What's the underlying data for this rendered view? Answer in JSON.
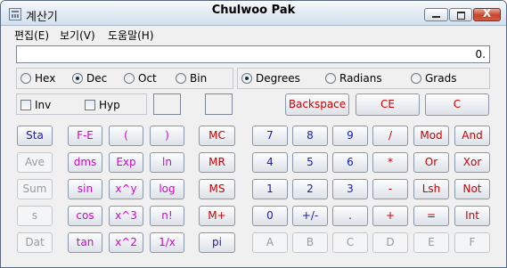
{
  "window": {
    "app_name": "계산기",
    "title": "Chulwoo Pak",
    "controls": {
      "close": "X"
    }
  },
  "menu": [
    "편집(E)",
    "보기(V)",
    "도움말(H)"
  ],
  "display": {
    "value": "0."
  },
  "colors": {
    "blue": "#1a1ab4",
    "red": "#cc0000",
    "magenta": "#d400d4",
    "disabled": "#9a9a9a"
  },
  "base_radios": [
    {
      "label": "Hex",
      "selected": false
    },
    {
      "label": "Dec",
      "selected": true
    },
    {
      "label": "Oct",
      "selected": false
    },
    {
      "label": "Bin",
      "selected": false
    }
  ],
  "angle_radios": [
    {
      "label": "Degrees",
      "selected": true
    },
    {
      "label": "Radians",
      "selected": false
    },
    {
      "label": "Grads",
      "selected": false
    }
  ],
  "checkboxes": [
    {
      "label": "Inv",
      "checked": false
    },
    {
      "label": "Hyp",
      "checked": false
    }
  ],
  "top_buttons": [
    "Backspace",
    "CE",
    "C"
  ],
  "stat_buttons": [
    {
      "label": "Sta",
      "enabled": true
    },
    {
      "label": "Ave",
      "enabled": false
    },
    {
      "label": "Sum",
      "enabled": false
    },
    {
      "label": "s",
      "enabled": false
    },
    {
      "label": "Dat",
      "enabled": false
    }
  ],
  "function_buttons": [
    [
      "F-E",
      "(",
      ")"
    ],
    [
      "dms",
      "Exp",
      "ln"
    ],
    [
      "sin",
      "x^y",
      "log"
    ],
    [
      "cos",
      "x^3",
      "n!"
    ],
    [
      "tan",
      "x^2",
      "1/x"
    ]
  ],
  "memory_buttons": [
    "MC",
    "MR",
    "MS",
    "M+",
    "pi"
  ],
  "number_pad": [
    [
      "7",
      "8",
      "9",
      "/",
      "Mod",
      "And"
    ],
    [
      "4",
      "5",
      "6",
      "*",
      "Or",
      "Xor"
    ],
    [
      "1",
      "2",
      "3",
      "-",
      "Lsh",
      "Not"
    ],
    [
      "0",
      "+/-",
      ".",
      "+",
      "=",
      "Int"
    ],
    [
      "A",
      "B",
      "C",
      "D",
      "E",
      "F"
    ]
  ]
}
